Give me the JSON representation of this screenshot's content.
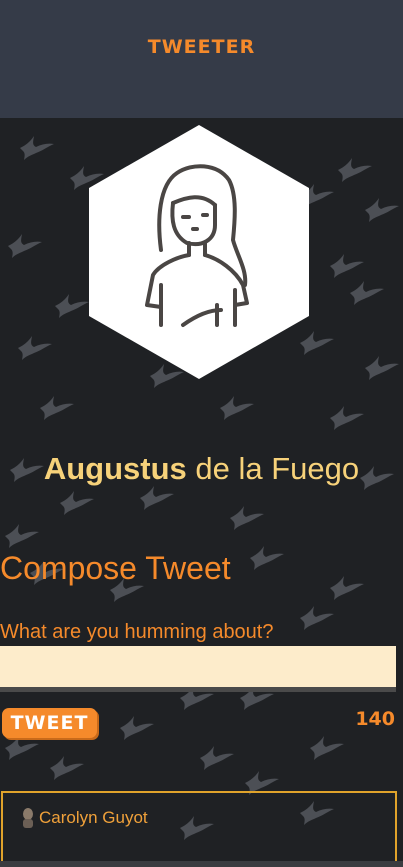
{
  "header": {
    "brand": "TWEETER"
  },
  "profile": {
    "first_name": "Augustus",
    "last_name": "de la Fuego",
    "avatar_icon": "person-avatar-icon"
  },
  "compose": {
    "title": "Compose Tweet",
    "label": "What are you humming about?",
    "value": "",
    "button_label": "TWEET",
    "char_count": "140"
  },
  "tweets": [
    {
      "author": "Carolyn Guyot",
      "avatar_icon": "user-avatar-icon"
    }
  ],
  "colors": {
    "header_bg": "#353b48",
    "page_bg": "#1f2124",
    "accent": "#f58a2b",
    "name": "#f7d27a",
    "input_bg": "#fdeccb",
    "card_border": "#e0a32b"
  }
}
